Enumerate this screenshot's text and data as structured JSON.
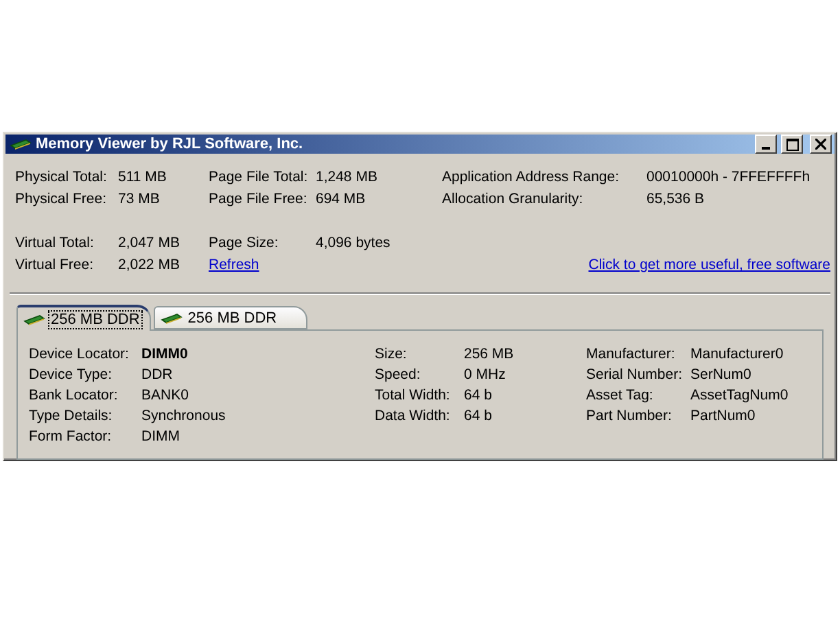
{
  "window": {
    "title": "Memory Viewer by RJL Software, Inc."
  },
  "info": {
    "rows": [
      [
        {
          "kind": "pair",
          "label": "Physical Total:",
          "value": "511 MB"
        },
        {
          "kind": "pair",
          "label": "Page File Total:",
          "value": "1,248 MB"
        },
        {
          "kind": "pair",
          "label": "Application Address Range:",
          "value": "00010000h - 7FFEFFFFh"
        }
      ],
      [
        {
          "kind": "pair",
          "label": "Physical Free:",
          "value": "73 MB"
        },
        {
          "kind": "pair",
          "label": "Page File Free:",
          "value": "694 MB"
        },
        {
          "kind": "pair",
          "label": "Allocation Granularity:",
          "value": "65,536 B"
        }
      ],
      [
        {
          "kind": "pair",
          "label": "Virtual Total:",
          "value": "2,047 MB"
        },
        {
          "kind": "pair",
          "label": "Page Size:",
          "value": "4,096 bytes"
        }
      ],
      [
        {
          "kind": "pair",
          "label": "Virtual Free:",
          "value": "2,022 MB"
        },
        {
          "kind": "link",
          "text": "Refresh"
        },
        {
          "kind": "promo",
          "text": "Click to get more useful, free software"
        }
      ]
    ]
  },
  "tabs": [
    {
      "label": "256 MB DDR",
      "selected": true
    },
    {
      "label": "256 MB DDR",
      "selected": false
    }
  ],
  "details": {
    "columns": [
      [
        {
          "label": "Device Locator:",
          "value": "DIMM0",
          "bold": true
        },
        {
          "label": "Device Type:",
          "value": "DDR",
          "bold": false
        },
        {
          "label": "Bank Locator:",
          "value": "BANK0",
          "bold": false
        },
        {
          "label": "Type Details:",
          "value": "Synchronous",
          "bold": false
        },
        {
          "label": "Form Factor:",
          "value": "DIMM",
          "bold": false
        }
      ],
      [
        {
          "label": "Size:",
          "value": "256 MB",
          "bold": false
        },
        {
          "label": "Speed:",
          "value": "0 MHz",
          "bold": false
        },
        {
          "label": "Total Width:",
          "value": "64 b",
          "bold": false
        },
        {
          "label": "Data Width:",
          "value": "64 b",
          "bold": false
        }
      ],
      [
        {
          "label": "Manufacturer:",
          "value": "Manufacturer0",
          "bold": false
        },
        {
          "label": "Serial Number:",
          "value": "SerNum0",
          "bold": false
        },
        {
          "label": "Asset Tag:",
          "value": "AssetTagNum0",
          "bold": false
        },
        {
          "label": "Part Number:",
          "value": "PartNum0",
          "bold": false
        }
      ]
    ]
  }
}
